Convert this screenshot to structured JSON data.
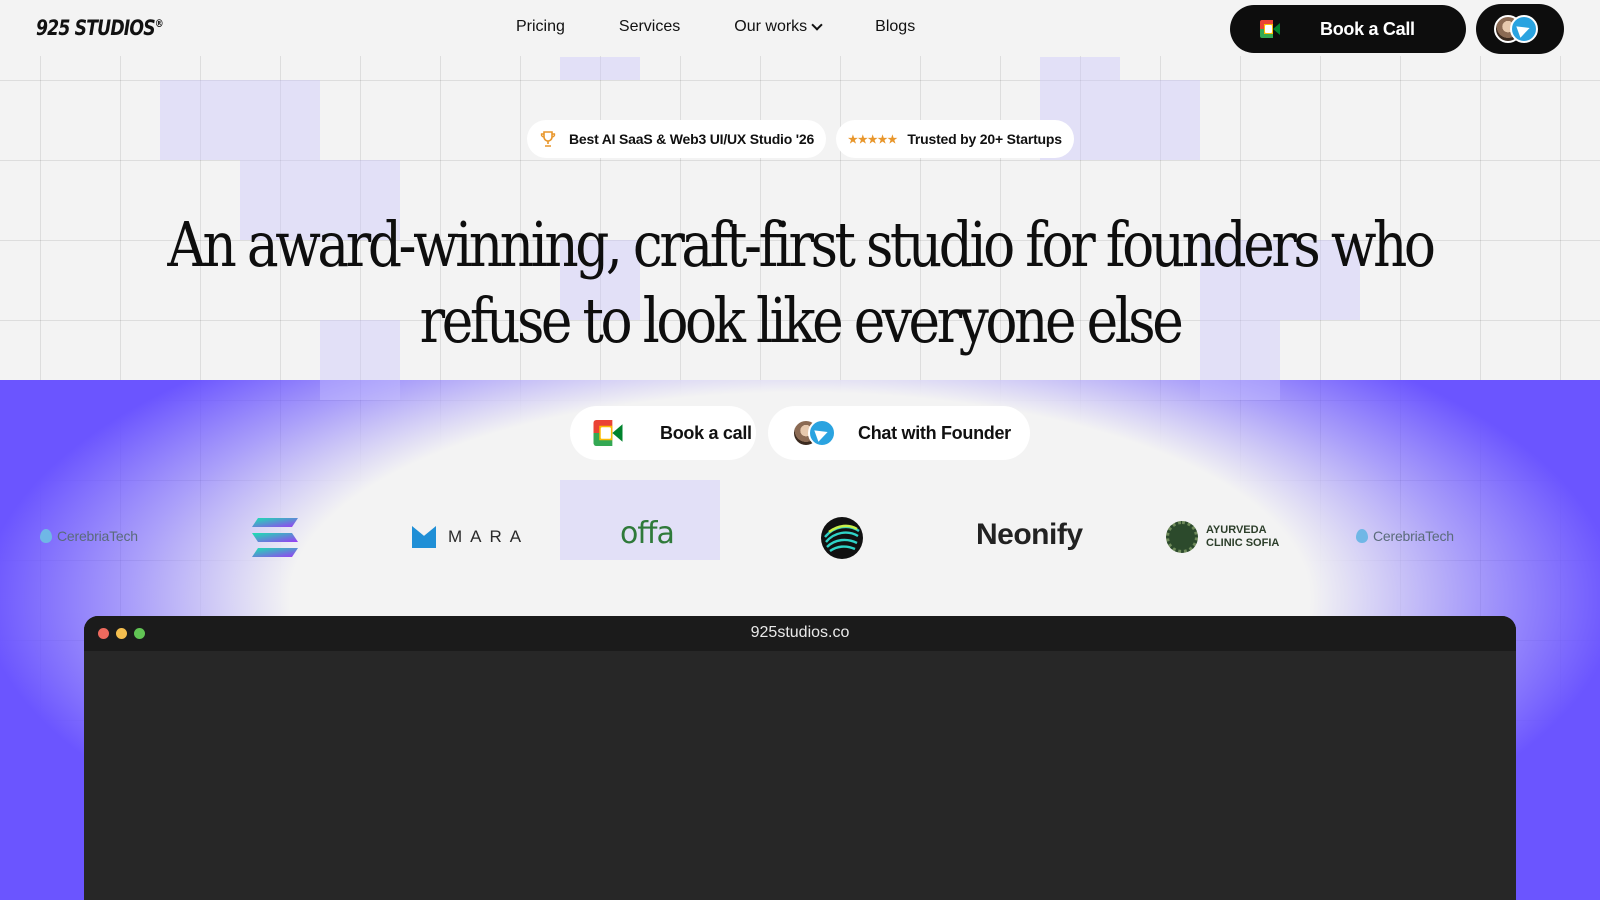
{
  "nav": {
    "logo": "925 STUDIOS",
    "logo_mark": "®",
    "links": [
      "Pricing",
      "Services",
      "Our works",
      "Blogs"
    ],
    "book_call": "Book a Call"
  },
  "badges": {
    "award": "Best AI SaaS & Web3 UI/UX Studio '26",
    "trusted": "Trusted by 20+ Startups",
    "stars": "★★★★★"
  },
  "hero": {
    "line1": "An award-winning, craft-first studio for founders who",
    "line2": "refuse to look like everyone else"
  },
  "cta": {
    "book": "Book a call",
    "chat": "Chat with Founder"
  },
  "clients": {
    "cerebria": "CerebriaTech",
    "mara": "MARA",
    "offa": "offa",
    "neonify": "Neonify",
    "ayurveda_1": "AYURVEDA",
    "ayurveda_2": "CLINIC SOFIA"
  },
  "browser": {
    "url": "925studios.co"
  },
  "colors": {
    "accent_purple": "#6b55ff",
    "dark": "#0d0d0d"
  }
}
